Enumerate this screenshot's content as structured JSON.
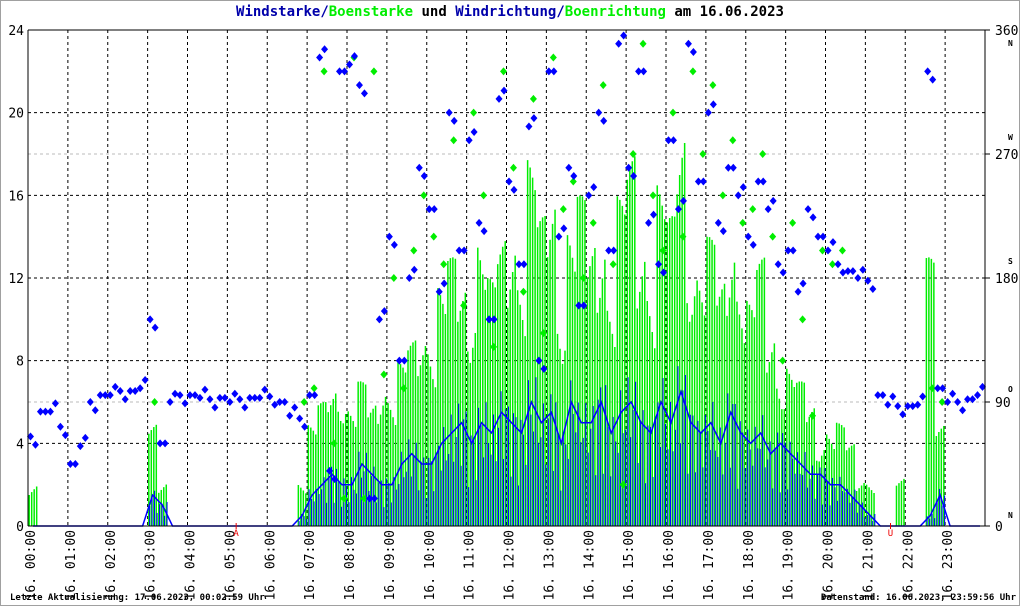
{
  "chart_data": {
    "type": "line",
    "title_parts": [
      {
        "text": "Windstarke",
        "color": "#0000aa"
      },
      {
        "text": "/",
        "color": "#0000aa"
      },
      {
        "text": "Boenstarke",
        "color": "#00ee00"
      },
      {
        "text": " und ",
        "color": "#000000"
      },
      {
        "text": "Windrichtung",
        "color": "#0000aa"
      },
      {
        "text": "/",
        "color": "#0000aa"
      },
      {
        "text": "Boenrichtung",
        "color": "#00ee00"
      },
      {
        "text": " am 16.06.2023",
        "color": "#000000"
      }
    ],
    "ylim_left": [
      0,
      24
    ],
    "yticks_left": [
      "0",
      "4",
      "8",
      "12",
      "16",
      "20",
      "24"
    ],
    "ylim_right": [
      0,
      360
    ],
    "yticks_right": [
      "0",
      "90",
      "180",
      "270",
      "360"
    ],
    "compass_labels": [
      {
        "deg": 0,
        "label": "N"
      },
      {
        "deg": 90,
        "label": "O"
      },
      {
        "deg": 180,
        "label": "S"
      },
      {
        "deg": 270,
        "label": "W"
      },
      {
        "deg": 360,
        "label": "N"
      }
    ],
    "xticks": [
      "16. 00:00",
      "16. 01:00",
      "16. 02:00",
      "16. 03:00",
      "16. 04:00",
      "16. 05:00",
      "16. 06:00",
      "16. 07:00",
      "16. 08:00",
      "16. 09:00",
      "16. 10:00",
      "16. 11:00",
      "16. 12:00",
      "16. 13:00",
      "16. 14:00",
      "16. 15:00",
      "16. 16:00",
      "16. 17:00",
      "16. 18:00",
      "16. 19:00",
      "16. 20:00",
      "16. 21:00",
      "16. 22:00",
      "16. 23:00"
    ],
    "markers": [
      {
        "hour": 5.22,
        "label": "A"
      },
      {
        "hour": 21.63,
        "label": "U"
      }
    ],
    "interval_hours": 0.25,
    "series": [
      {
        "name": "Windstarke",
        "color": "#0000ff",
        "values": [
          0,
          0,
          0,
          0,
          0,
          0,
          0,
          0,
          0,
          0,
          0,
          0,
          1.5,
          1,
          0,
          0,
          0,
          0,
          0,
          0,
          0,
          0,
          0,
          0,
          0,
          0,
          0,
          0.5,
          1.5,
          2,
          2.5,
          2,
          2,
          3,
          2.5,
          2,
          2,
          3,
          3.5,
          3,
          3,
          4,
          4.5,
          5,
          4,
          5,
          4.5,
          5.5,
          5,
          4.5,
          6,
          5,
          5.5,
          4,
          6,
          5,
          5,
          6,
          4.5,
          5.5,
          6,
          5,
          4.5,
          6,
          5,
          6.5,
          5,
          4.5,
          5,
          4,
          5.5,
          4.5,
          4,
          4.5,
          3.5,
          4,
          3.5,
          3,
          2.5,
          2.5,
          2,
          2,
          1.5,
          1,
          0.5,
          0,
          0,
          0,
          0,
          0,
          0.5,
          1.5,
          0,
          0,
          0,
          0
        ]
      },
      {
        "name": "Boenstarke",
        "color": "#00ee00",
        "values": [
          2.5,
          0,
          0,
          0,
          0,
          0,
          0,
          0,
          0,
          0,
          0,
          0,
          5,
          2.5,
          0,
          0,
          0,
          0,
          0,
          0,
          0,
          0,
          0,
          0,
          0,
          0,
          0,
          2.5,
          5,
          6,
          7,
          8,
          6,
          7,
          6,
          8,
          7,
          8,
          9,
          10,
          11,
          12,
          13,
          12,
          13,
          15,
          12,
          14,
          16,
          14,
          18,
          15,
          17,
          13,
          15,
          16,
          14,
          17,
          12,
          16,
          18,
          15,
          14,
          17,
          15,
          20,
          16,
          13,
          14,
          12,
          16,
          13,
          11,
          13,
          10,
          9,
          8,
          7,
          6,
          5,
          5,
          5,
          4,
          2.5,
          2.5,
          0,
          0,
          2.5,
          0,
          0,
          13,
          5,
          0,
          0,
          0,
          0
        ]
      },
      {
        "name": "Windrichtung",
        "color": "#0000ff",
        "values": [
          65,
          83,
          83,
          72,
          45,
          58,
          90,
          95,
          95,
          98,
          98,
          100,
          150,
          60,
          90,
          95,
          95,
          93,
          92,
          93,
          90,
          92,
          93,
          93,
          94,
          90,
          80,
          78,
          95,
          340,
          40,
          330,
          335,
          320,
          20,
          150,
          210,
          120,
          180,
          260,
          230,
          170,
          300,
          200,
          280,
          220,
          150,
          310,
          250,
          190,
          290,
          120,
          330,
          210,
          260,
          160,
          240,
          300,
          200,
          350,
          260,
          330,
          220,
          190,
          280,
          230,
          350,
          250,
          300,
          220,
          260,
          240,
          210,
          250,
          230,
          190,
          200,
          170,
          230,
          210,
          200,
          190,
          185,
          180,
          178,
          95,
          88,
          87,
          87,
          88,
          330,
          100,
          90,
          90,
          92,
          95
        ]
      },
      {
        "name": "Boenrichtung",
        "color": "#00ee00",
        "values": [
          null,
          null,
          null,
          null,
          null,
          null,
          null,
          null,
          null,
          null,
          null,
          null,
          90,
          null,
          null,
          null,
          null,
          null,
          null,
          null,
          null,
          null,
          null,
          null,
          null,
          null,
          null,
          90,
          100,
          330,
          60,
          20,
          340,
          20,
          330,
          110,
          180,
          100,
          200,
          240,
          210,
          190,
          280,
          160,
          300,
          240,
          130,
          330,
          260,
          170,
          310,
          140,
          340,
          230,
          250,
          180,
          220,
          320,
          190,
          30,
          270,
          350,
          240,
          200,
          300,
          210,
          330,
          270,
          320,
          240,
          280,
          220,
          230,
          270,
          210,
          120,
          220,
          150,
          80,
          200,
          190,
          200,
          null,
          null,
          null,
          null,
          null,
          null,
          null,
          null,
          100,
          90,
          null,
          null,
          null,
          null
        ]
      }
    ]
  },
  "footer": {
    "left": "Letzte Aktualisierung: 17.06.2023, 00:02:59 Uhr",
    "right": "Datenstand: 16.06.2023, 23:59:56 Uhr"
  }
}
